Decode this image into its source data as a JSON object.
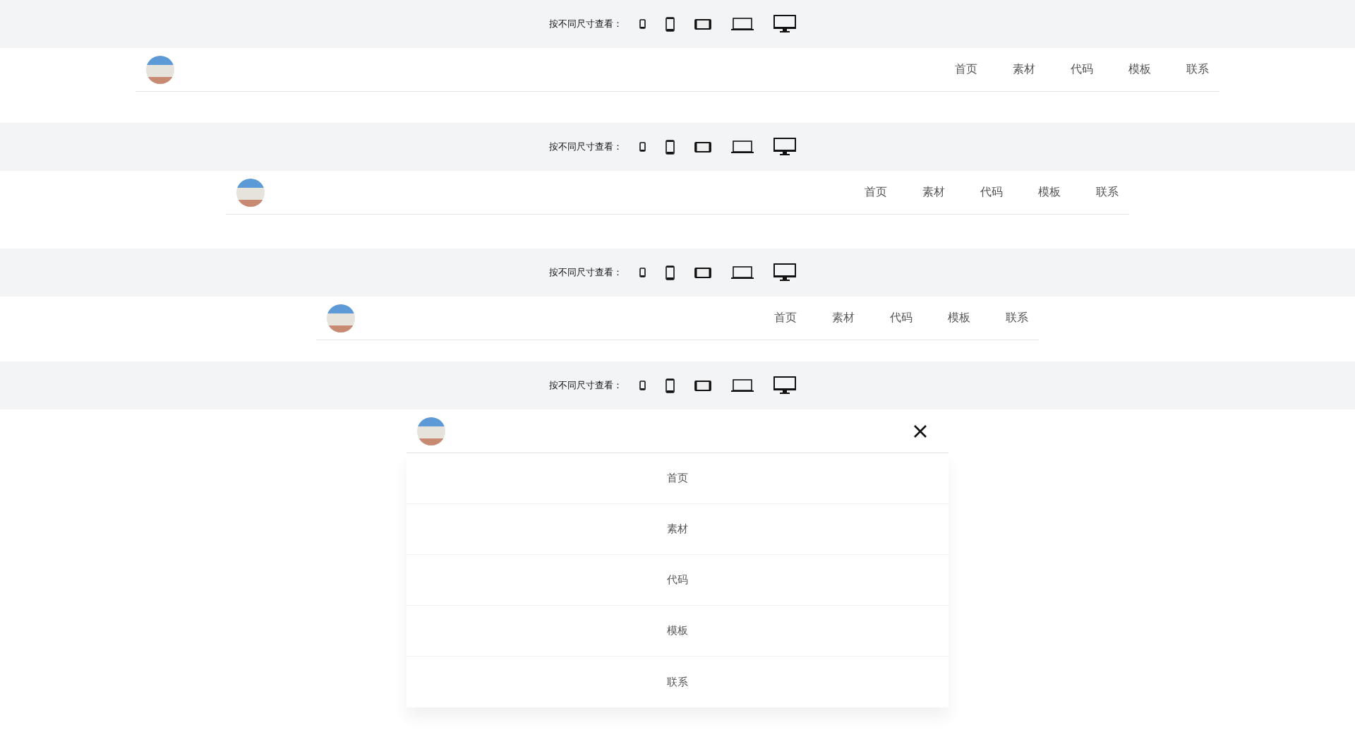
{
  "sections": [
    {
      "toolbar_label": "按不同尺寸查看：",
      "kind": "wide",
      "menu_open": false,
      "nav": [
        "首页",
        "素材",
        "代码",
        "模板",
        "联系"
      ]
    },
    {
      "toolbar_label": "按不同尺寸查看：",
      "kind": "large",
      "menu_open": false,
      "nav": [
        "首页",
        "素材",
        "代码",
        "模板",
        "联系"
      ]
    },
    {
      "toolbar_label": "按不同尺寸查看：",
      "kind": "medium",
      "menu_open": false,
      "nav": [
        "首页",
        "素材",
        "代码",
        "模板",
        "联系"
      ]
    },
    {
      "toolbar_label": "按不同尺寸查看：",
      "kind": "mobile",
      "menu_open": true,
      "nav": [
        "首页",
        "素材",
        "代码",
        "模板",
        "联系"
      ]
    }
  ]
}
